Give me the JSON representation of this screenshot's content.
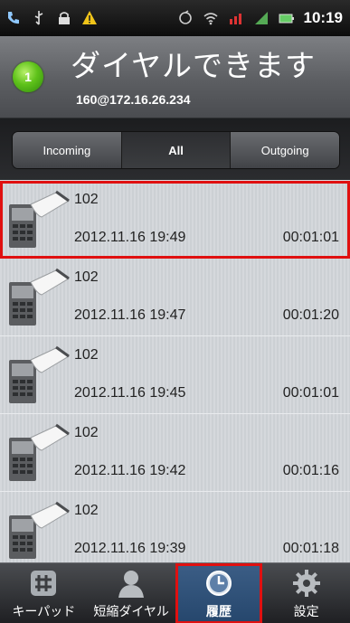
{
  "statusbar": {
    "time": "10:19",
    "left_icons": [
      "phone-call-icon",
      "usb-icon",
      "lock-icon",
      "warning-icon"
    ],
    "right_icons": [
      "sync-icon",
      "wifi-icon",
      "signal-off-icon",
      "signal-icon",
      "battery-icon"
    ]
  },
  "header": {
    "status_badge": "1",
    "status_text": "ダイヤルできます",
    "account": "160@172.16.26.234"
  },
  "filter_tabs": [
    {
      "label": "Incoming",
      "active": false
    },
    {
      "label": "All",
      "active": true
    },
    {
      "label": "Outgoing",
      "active": false
    }
  ],
  "calls": [
    {
      "name": "102",
      "datetime": "2012.11.16 19:49",
      "duration": "00:01:01",
      "selected": true
    },
    {
      "name": "102",
      "datetime": "2012.11.16 19:47",
      "duration": "00:01:20",
      "selected": false
    },
    {
      "name": "102",
      "datetime": "2012.11.16 19:45",
      "duration": "00:01:01",
      "selected": false
    },
    {
      "name": "102",
      "datetime": "2012.11.16 19:42",
      "duration": "00:01:16",
      "selected": false
    },
    {
      "name": "102",
      "datetime": "2012.11.16 19:39",
      "duration": "00:01:18",
      "selected": false
    }
  ],
  "bottom_nav": [
    {
      "label": "キーパッド",
      "icon": "keypad-icon",
      "active": false
    },
    {
      "label": "短縮ダイヤル",
      "icon": "contact-icon",
      "active": false
    },
    {
      "label": "履歴",
      "icon": "clock-icon",
      "active": true
    },
    {
      "label": "設定",
      "icon": "gear-icon",
      "active": false
    }
  ],
  "colors": {
    "highlight": "#e01010",
    "status_green": "#5fc21a",
    "active_nav": "#2f5078"
  }
}
